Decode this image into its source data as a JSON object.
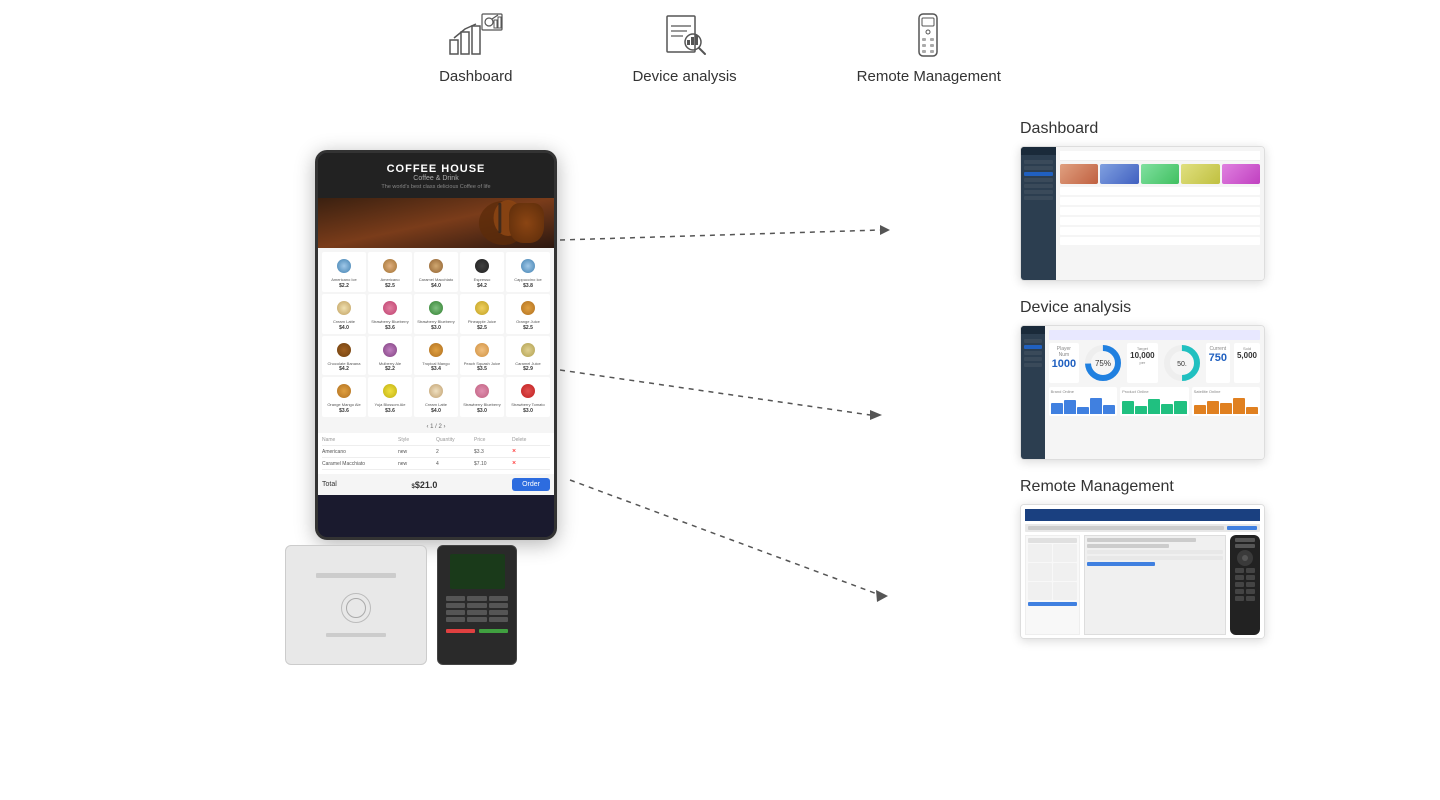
{
  "topNav": {
    "items": [
      {
        "id": "dashboard",
        "label": "Dashboard",
        "icon": "dashboard-icon"
      },
      {
        "id": "device-analysis",
        "label": "Device analysis",
        "icon": "device-analysis-icon"
      },
      {
        "id": "remote-management",
        "label": "Remote Management",
        "icon": "remote-management-icon"
      }
    ]
  },
  "kiosk": {
    "brand": "COFFEE HOUSE",
    "subtitle": "Coffee & Drink",
    "description": "The world's best class delicious Coffee of life",
    "menuItems": [
      {
        "name": "Americano Ice",
        "price": "$2.2",
        "type": "iced"
      },
      {
        "name": "Americano",
        "price": "$2.5",
        "type": "hot"
      },
      {
        "name": "Caramel\nMacchiato",
        "price": "$4.0",
        "type": "hot"
      },
      {
        "name": "Espresso",
        "price": "$4.2",
        "type": "hot"
      },
      {
        "name": "Cappuccino Ice",
        "price": "$3.8",
        "type": "iced"
      },
      {
        "name": "Cream Latte",
        "price": "$4.0",
        "type": "hot"
      },
      {
        "name": "Strawberry Blueberry Juice",
        "price": "$3.6",
        "type": "cold"
      },
      {
        "name": "Strawberry Blueberry Juice",
        "price": "$3.0",
        "type": "cold"
      },
      {
        "name": "Pineapple Juice",
        "price": "$2.5",
        "type": "cold"
      },
      {
        "name": "Orange Juice",
        "price": "$2.5",
        "type": "orange"
      },
      {
        "name": "Chocolate Banana Juice",
        "price": "$4.2",
        "type": "cold"
      },
      {
        "name": "Mulberry Ale",
        "price": "$2.2",
        "type": "cold"
      },
      {
        "name": "Tropical Mango",
        "price": "$3.4",
        "type": "orange"
      },
      {
        "name": "Peach Squash Juice",
        "price": "$3.5",
        "type": "orange"
      },
      {
        "name": "Caramel Juice",
        "price": "$2.9",
        "type": "hot"
      },
      {
        "name": "Orange Mango Ale",
        "price": "$3.6",
        "type": "orange"
      },
      {
        "name": "Yuja Blossom Ale",
        "price": "$3.6",
        "type": "orange"
      },
      {
        "name": "Cream Latte",
        "price": "$4.0",
        "type": "hot"
      },
      {
        "name": "Strawberry Blueberry Juice",
        "price": "$3.0",
        "type": "cold"
      },
      {
        "name": "Strawberry Tomato Juice",
        "price": "$3.0",
        "type": "cold"
      }
    ],
    "pagination": "1 / 2",
    "orderItems": [
      {
        "name": "Americano",
        "style": "new",
        "qty": "2",
        "price": "$3.3",
        "delete": "×"
      },
      {
        "name": "Caramel Macchiato",
        "style": "new",
        "qty": "4",
        "price": "$7.10",
        "delete": "×"
      }
    ],
    "orderTotal": "$21.0",
    "orderButton": "Order"
  },
  "rightPanels": {
    "dashboard": {
      "title": "Dashboard",
      "description": "Dashboard screenshot"
    },
    "deviceAnalysis": {
      "title": "Device analysis",
      "description": "Device analysis screenshot",
      "stats": {
        "total": "1000",
        "rate": "75%",
        "target": "10,000",
        "daily": "50",
        "current": "750",
        "sold": "5,000"
      }
    },
    "remoteManagement": {
      "title": "Remote Management",
      "description": "Remote management screenshot"
    }
  },
  "arrows": {
    "line1": "Dashboard arrow",
    "line2": "Device analysis arrow",
    "line3": "Remote Management arrow"
  }
}
